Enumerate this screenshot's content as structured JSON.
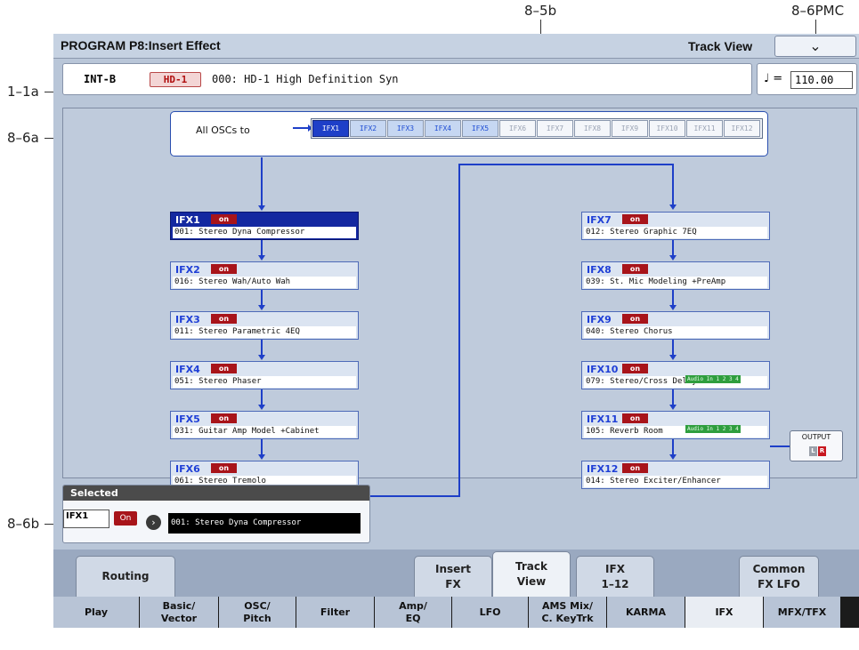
{
  "callouts": {
    "c85b": "8–5b",
    "c86pmc": "8–6PMC",
    "c11a": "1–1a",
    "c86a": "8–6a",
    "c86b": "8–6b"
  },
  "header": {
    "title": "PROGRAM P8:Insert Effect",
    "page_label": "Track View",
    "menu_icon": "chevron-down-icon"
  },
  "program": {
    "bank": "INT-B",
    "type_badge": "HD-1",
    "name": "000: HD-1 High Definition Syn",
    "tempo_symbol": "♩ =",
    "tempo": "110.00"
  },
  "routing": {
    "all_oscs_label": "All OSCs to",
    "buttons": [
      {
        "label": "IFX1",
        "state": "selected"
      },
      {
        "label": "IFX2",
        "state": "active"
      },
      {
        "label": "IFX3",
        "state": "active"
      },
      {
        "label": "IFX4",
        "state": "active"
      },
      {
        "label": "IFX5",
        "state": "active"
      },
      {
        "label": "IFX6",
        "state": "inactive"
      },
      {
        "label": "IFX7",
        "state": "inactive"
      },
      {
        "label": "IFX8",
        "state": "inactive"
      },
      {
        "label": "IFX9",
        "state": "inactive"
      },
      {
        "label": "IFX10",
        "state": "inactive"
      },
      {
        "label": "IFX11",
        "state": "inactive"
      },
      {
        "label": "IFX12",
        "state": "inactive"
      }
    ],
    "ifx": [
      {
        "name": "IFX1",
        "on": "on",
        "effect": "001: Stereo Dyna Compressor"
      },
      {
        "name": "IFX2",
        "on": "on",
        "effect": "016: Stereo Wah/Auto Wah"
      },
      {
        "name": "IFX3",
        "on": "on",
        "effect": "011: Stereo Parametric 4EQ"
      },
      {
        "name": "IFX4",
        "on": "on",
        "effect": "051: Stereo Phaser"
      },
      {
        "name": "IFX5",
        "on": "on",
        "effect": "031: Guitar Amp Model +Cabinet"
      },
      {
        "name": "IFX6",
        "on": "on",
        "effect": "061: Stereo Tremolo"
      },
      {
        "name": "IFX7",
        "on": "on",
        "effect": "012: Stereo Graphic 7EQ"
      },
      {
        "name": "IFX8",
        "on": "on",
        "effect": "039: St. Mic Modeling +PreAmp"
      },
      {
        "name": "IFX9",
        "on": "on",
        "effect": "040: Stereo Chorus"
      },
      {
        "name": "IFX10",
        "on": "on",
        "effect": "079: Stereo/Cross Delay"
      },
      {
        "name": "IFX11",
        "on": "on",
        "effect": "105: Reverb Room"
      },
      {
        "name": "IFX12",
        "on": "on",
        "effect": "014: Stereo Exciter/Enhancer"
      }
    ],
    "audio_in": "Audio In 1 2 3 4",
    "output": {
      "label": "OUTPUT",
      "l": "L",
      "r": "R"
    }
  },
  "selected": {
    "header": "Selected",
    "ifx": "IFX1",
    "on": "On",
    "effect": "001: Stereo Dyna Compressor"
  },
  "upper_tabs": [
    {
      "label": "Routing",
      "active": false
    },
    {
      "label": "Insert\nFX",
      "active": false
    },
    {
      "label": "Track\nView",
      "active": true
    },
    {
      "label": "IFX\n1–12",
      "active": false
    },
    {
      "label": "Common\nFX LFO",
      "active": false
    }
  ],
  "bottom_tabs": [
    {
      "label": "Play",
      "active": false
    },
    {
      "label": "Basic/\nVector",
      "active": false
    },
    {
      "label": "OSC/\nPitch",
      "active": false
    },
    {
      "label": "Filter",
      "active": false
    },
    {
      "label": "Amp/\nEQ",
      "active": false
    },
    {
      "label": "LFO",
      "active": false
    },
    {
      "label": "AMS Mix/\nC. KeyTrk",
      "active": false
    },
    {
      "label": "KARMA",
      "active": false
    },
    {
      "label": "IFX",
      "active": true
    },
    {
      "label": "MFX/TFX",
      "active": false
    }
  ],
  "colors": {
    "accent_blue": "#1e3fc8",
    "on_red": "#a8141a",
    "audio_in_green": "#2f9e3e"
  }
}
